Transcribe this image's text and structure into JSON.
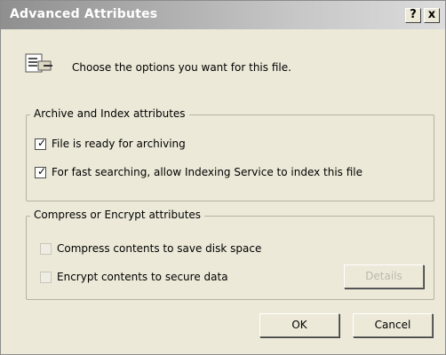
{
  "window": {
    "title": "Advanced Attributes",
    "help_label": "?",
    "close_label": "x"
  },
  "header": {
    "icon": "folder-file-icon",
    "text": "Choose the options you want for this file."
  },
  "archive_group": {
    "legend": "Archive and Index attributes",
    "archive_label": "File is ready for archiving",
    "archive_checked": true,
    "index_label": "For fast searching, allow Indexing Service to index this file",
    "index_checked": true
  },
  "compress_group": {
    "legend": "Compress or Encrypt attributes",
    "compress_label": "Compress contents to save disk space",
    "compress_checked": false,
    "encrypt_label": "Encrypt contents to secure data",
    "encrypt_checked": false,
    "details_label": "Details"
  },
  "buttons": {
    "ok": "OK",
    "cancel": "Cancel"
  },
  "icons": {
    "check": "✓"
  }
}
